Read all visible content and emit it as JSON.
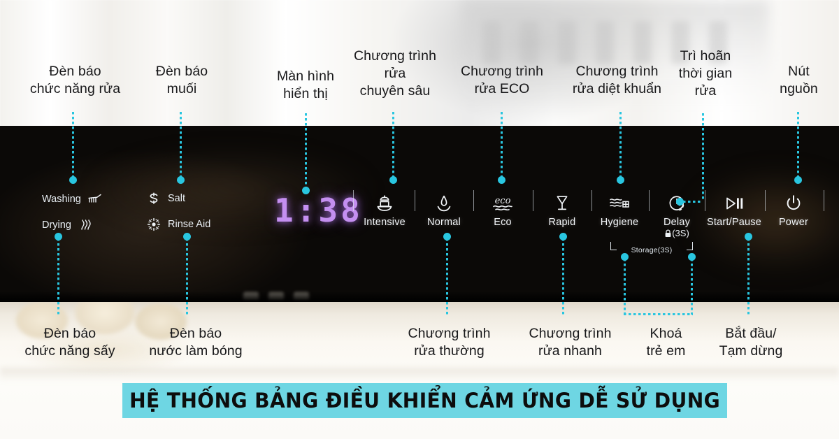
{
  "panel": {
    "display_value": "1:38",
    "indicators": [
      {
        "label": "Washing",
        "icon": "brush-icon"
      },
      {
        "label": "Drying",
        "icon": "heat-waves-icon"
      },
      {
        "label": "Salt",
        "icon": "salt-cycle-icon"
      },
      {
        "label": "Rinse Aid",
        "icon": "rinse-aid-star-icon"
      }
    ],
    "buttons": [
      {
        "label": "Intensive",
        "icon": "pot-icon"
      },
      {
        "label": "Normal",
        "icon": "droplet-bowl-icon"
      },
      {
        "label": "Eco",
        "icon": "eco-waves-icon"
      },
      {
        "label": "Rapid",
        "icon": "glass-icon"
      },
      {
        "label": "Hygiene",
        "icon": "waves-grid-icon"
      },
      {
        "label": "Delay",
        "icon": "clock-icon",
        "sub": "(\u0001F512 3S)"
      },
      {
        "label": "Start/Pause",
        "icon": "play-pause-icon"
      },
      {
        "label": "Power",
        "icon": "power-icon"
      }
    ],
    "delay_sub": "(⑑3S)",
    "storage_note": "Storage(3S)"
  },
  "callouts": {
    "top": [
      {
        "id": "washing-indicator",
        "text": "Đèn báo\nchức năng rửa"
      },
      {
        "id": "salt-indicator",
        "text": "Đèn báo\nmuối"
      },
      {
        "id": "display-screen",
        "text": "Màn hình\nhiển thị"
      },
      {
        "id": "intensive-program",
        "text": "Chương trình\nrửa\nchuyên sâu"
      },
      {
        "id": "eco-program",
        "text": "Chương trình\nrửa ECO"
      },
      {
        "id": "hygiene-program",
        "text": "Chương trình\nrửa diệt khuẩn"
      },
      {
        "id": "delay-program",
        "text": "Trì hoãn\nthời gian\nrửa"
      },
      {
        "id": "power-button",
        "text": "Nút\nnguồn"
      }
    ],
    "bottom": [
      {
        "id": "drying-indicator",
        "text": "Đèn báo\nchức năng sấy"
      },
      {
        "id": "rinse-aid-indicator",
        "text": "Đèn báo\nnước làm bóng"
      },
      {
        "id": "normal-program",
        "text": "Chương trình\nrửa thường"
      },
      {
        "id": "rapid-program",
        "text": "Chương trình\nrửa nhanh"
      },
      {
        "id": "child-lock",
        "text": "Khoá\ntrẻ em"
      },
      {
        "id": "start-pause",
        "text": "Bắt đầu/\nTạm dừng"
      }
    ]
  },
  "banner": {
    "text": "HỆ THỐNG BẢNG ĐIỀU KHIỂN CẢM ỨNG DỄ SỬ DỤNG"
  },
  "colors": {
    "accent_cyan": "#29c6e0",
    "banner_bg": "#6ed6e3",
    "display_purple": "#c48ff0"
  }
}
